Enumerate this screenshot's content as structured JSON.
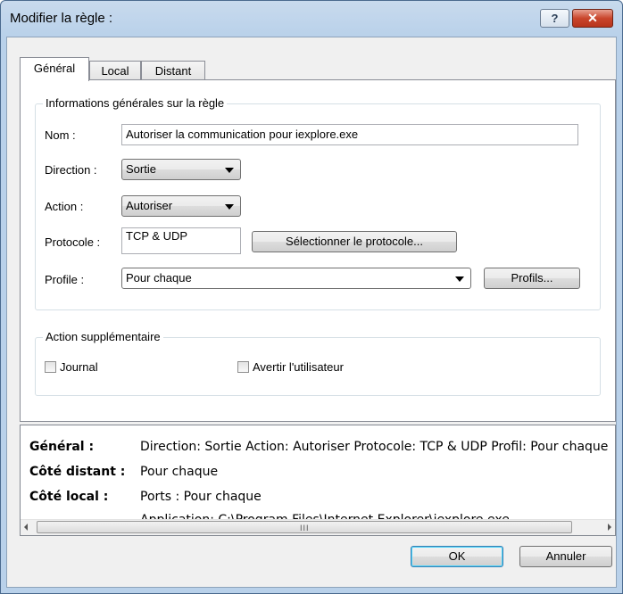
{
  "window": {
    "title": "Modifier la règle :",
    "help_label": "?",
    "close_label": "✕"
  },
  "tabs": [
    {
      "label": "Général",
      "active": true
    },
    {
      "label": "Local",
      "active": false
    },
    {
      "label": "Distant",
      "active": false
    }
  ],
  "general_info": {
    "legend": "Informations générales sur la règle",
    "name_label": "Nom :",
    "name_value": "Autoriser la communication pour iexplore.exe",
    "direction_label": "Direction :",
    "direction_value": "Sortie",
    "action_label": "Action :",
    "action_value": "Autoriser",
    "protocol_label": "Protocole :",
    "protocol_value": "TCP & UDP",
    "protocol_button": "Sélectionner le protocole...",
    "profile_label": "Profile :",
    "profile_value": "Pour chaque",
    "profiles_button": "Profils..."
  },
  "extra_action": {
    "legend": "Action supplémentaire",
    "log_label": "Journal",
    "log_checked": false,
    "notify_label": "Avertir l'utilisateur",
    "notify_checked": false
  },
  "summary": {
    "general_key": "Général :",
    "general_value": "Direction: Sortie   Action: Autoriser   Protocole: TCP & UDP   Profil: Pour chaque",
    "remote_key": "Côté distant :",
    "remote_value": "Pour chaque",
    "local_key": "Côté local :",
    "local_ports": "Ports : Pour chaque",
    "local_app": "Application: C:\\Program Files\\Internet Explorer\\iexplore.exe",
    "scroll_grip": "III"
  },
  "buttons": {
    "ok": "OK",
    "cancel": "Annuler"
  }
}
